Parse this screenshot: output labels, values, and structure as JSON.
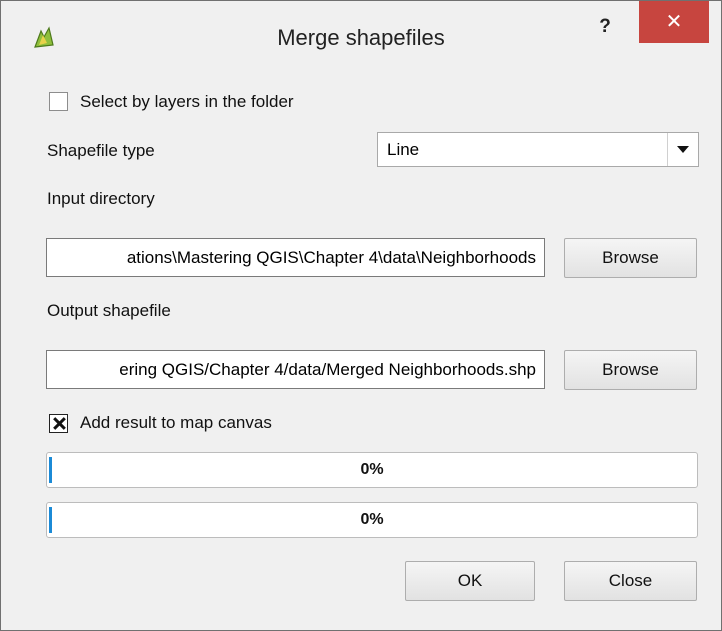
{
  "window": {
    "title": "Merge shapefiles",
    "help_label": "?",
    "close_label": "✕"
  },
  "form": {
    "select_by_layers": {
      "label": "Select by layers in the folder",
      "checked": false
    },
    "shapefile_type": {
      "label": "Shapefile type",
      "value": "Line"
    },
    "input_directory": {
      "label": "Input directory",
      "value": "ations\\Mastering QGIS\\Chapter 4\\data\\Neighborhoods",
      "browse_label": "Browse"
    },
    "output_shapefile": {
      "label": "Output shapefile",
      "value": "ering QGIS/Chapter 4/data/Merged Neighborhoods.shp",
      "browse_label": "Browse"
    },
    "add_result": {
      "label": "Add result to map canvas",
      "checked": true
    },
    "progress": [
      {
        "text": "0%",
        "value": 0
      },
      {
        "text": "0%",
        "value": 0
      }
    ]
  },
  "buttons": {
    "ok_label": "OK",
    "close_label": "Close"
  },
  "colors": {
    "close_button": "#c7453f",
    "progress_fill": "#1b8ad6"
  },
  "icons": {
    "app": "qgis-logo-icon",
    "help": "help-icon",
    "close": "close-icon",
    "dropdown": "chevron-down-icon"
  }
}
